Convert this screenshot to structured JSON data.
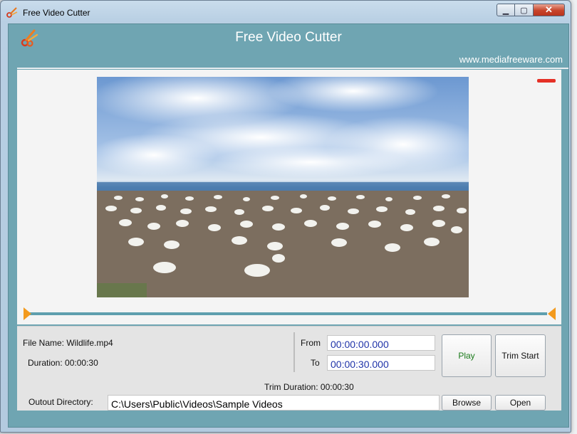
{
  "window": {
    "title": "Free Video Cutter",
    "caption": {
      "minimize": "▁",
      "maximize": "▢",
      "close": "✕"
    }
  },
  "header": {
    "app_title": "Free Video Cutter",
    "url": "www.mediafreeware.com"
  },
  "controls": {
    "file_name_label": "File Name: Wildlife.mp4",
    "duration_label": "Duration: 00:00:30",
    "from_label": "From",
    "to_label": "To",
    "from_value": "00:00:00.000",
    "to_value": "00:00:30.000",
    "trim_duration_label": "Trim Duration: 00:00:30",
    "play_label": "Play",
    "trim_start_label": "Trim Start",
    "output_dir_label": "Outout Directory:",
    "output_dir_value": "C:\\Users\\Public\\Videos\\Sample Videos",
    "browse_label": "Browse",
    "open_label": "Open"
  },
  "colors": {
    "accent": "#6fa5b2",
    "handle": "#f39a1d",
    "time_text": "#1f33a8",
    "play_text": "#1a7a1a"
  }
}
